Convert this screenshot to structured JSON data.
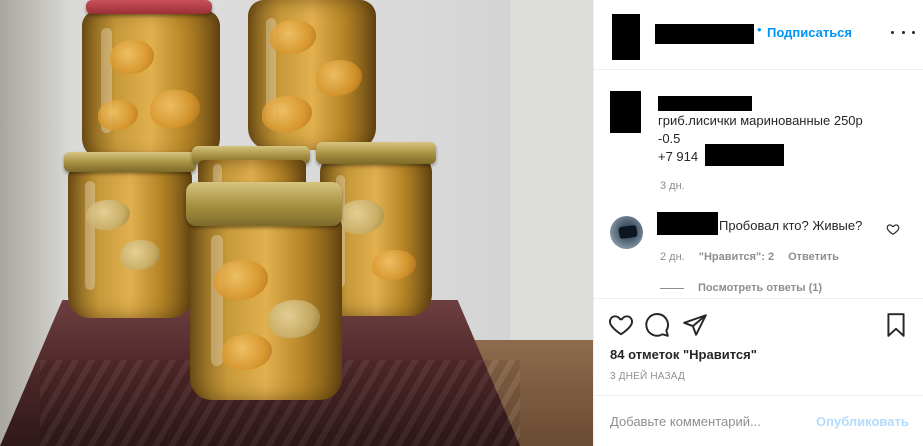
{
  "header": {
    "separator": "•",
    "follow_label": "Подписаться"
  },
  "caption": {
    "text": "Продам белый\nгриб.лисички маринованные 250р\n-0.5\n+7 914",
    "time": "3 дн."
  },
  "comment": {
    "text": "Пробовал кто? Живые?",
    "time": "2 дн.",
    "likes_label": "\"Нравится\": 2",
    "reply_label": "Ответить",
    "view_replies": "Посмотреть ответы (1)"
  },
  "actions": {
    "icons": [
      "heart-icon",
      "comment-icon",
      "share-icon",
      "bookmark-icon"
    ],
    "likes_count": "84 отметок \"Нравится\"",
    "posted": "3 ДНЕЙ НАЗАД"
  },
  "add_comment": {
    "placeholder": "Добавьте комментарий...",
    "publish_label": "Опубликовать"
  },
  "colors": {
    "accent": "#0095f6",
    "publish_disabled": "#b3dbff",
    "secondary_text": "#8e8e8e"
  }
}
